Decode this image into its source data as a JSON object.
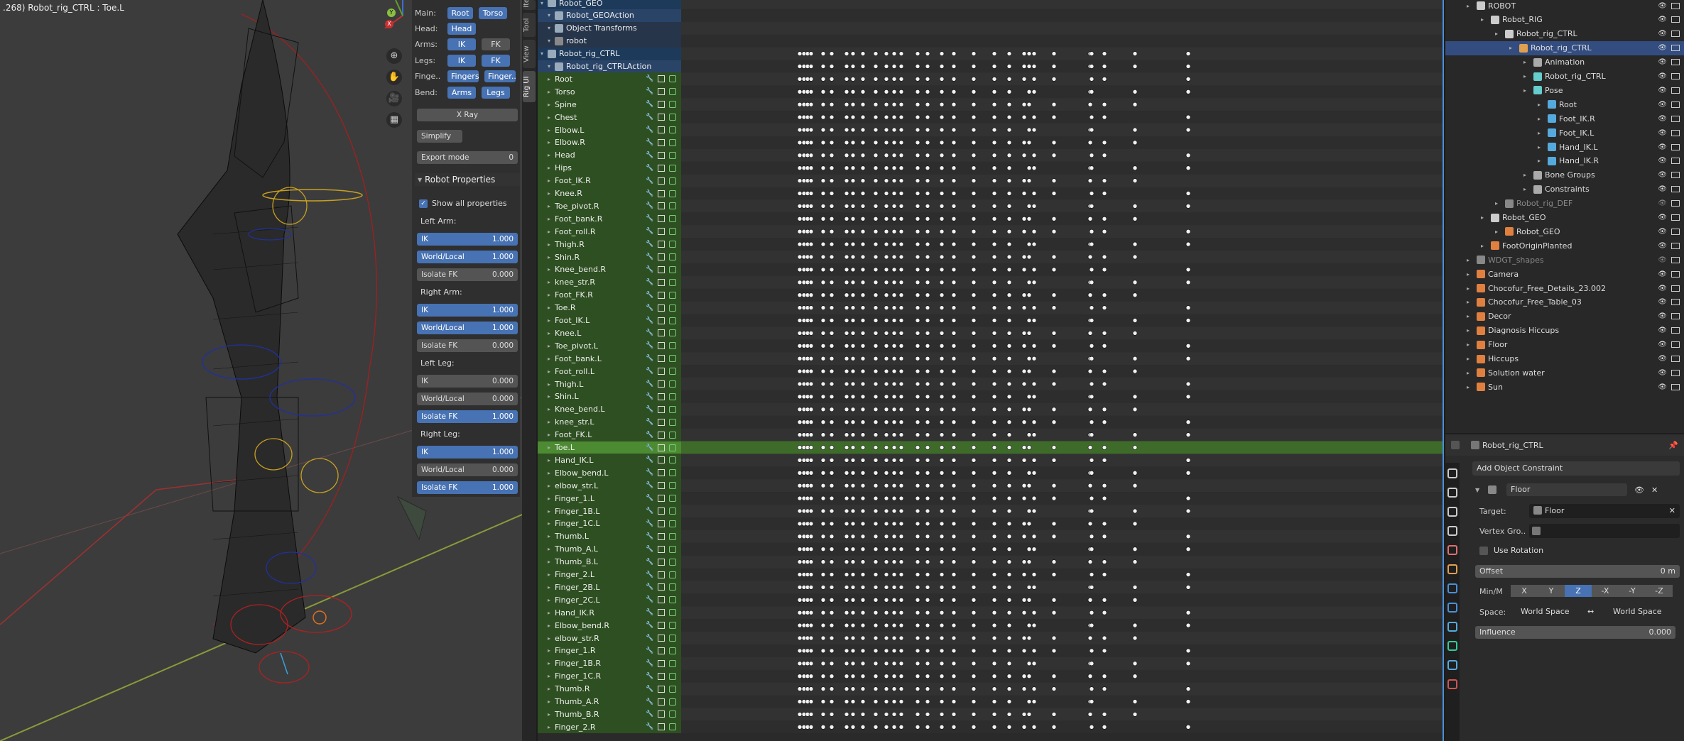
{
  "viewport": {
    "title": ".268) Robot_rig_CTRL : Toe.L"
  },
  "nav": {
    "x": "X",
    "y": "Y",
    "zoom": "⊕",
    "hand": "✋",
    "camera": "🎥",
    "grid": "▦"
  },
  "rigui": {
    "main": {
      "label": "Main:",
      "b1": "Root",
      "b2": "Torso"
    },
    "head": {
      "label": "Head:",
      "b1": "Head",
      "b2": ""
    },
    "arms": {
      "label": "Arms:",
      "b1": "IK",
      "b2": "FK"
    },
    "legs": {
      "label": "Legs:",
      "b1": "IK",
      "b2": "FK"
    },
    "fingers": {
      "label": "Finge..",
      "b1": "Fingers",
      "b2": "Finger.."
    },
    "bend": {
      "label": "Bend:",
      "b1": "Arms",
      "b2": "Legs"
    },
    "xray": "X Ray",
    "simplify": "Simplify",
    "export_label": "Export mode",
    "export_val": "0",
    "props_header": "Robot Properties",
    "show_all": "Show all properties",
    "left_arm": "Left Arm:",
    "right_arm": "Right Arm:",
    "left_leg": "Left Leg:",
    "right_leg": "Right Leg:",
    "ik": "IK",
    "wl": "World/Local",
    "iso": "Isolate FK",
    "la": [
      "1.000",
      "1.000",
      "0.000"
    ],
    "ra": [
      "1.000",
      "1.000",
      "0.000"
    ],
    "ll": [
      "0.000",
      "0.000",
      "1.000"
    ],
    "rl": [
      "1.000",
      "0.000",
      "1.000"
    ]
  },
  "tabs": [
    "Item",
    "Tool",
    "View",
    "Rig UI"
  ],
  "channels": {
    "top": [
      {
        "label": "Robot_GEO",
        "style": "o"
      },
      {
        "label": "Robot_GEOAction",
        "style": "o2"
      },
      {
        "label": "Object Transforms",
        "style": "o3"
      },
      {
        "label": "robot",
        "style": "o3"
      },
      {
        "label": "Robot_rig_CTRL",
        "style": "o"
      },
      {
        "label": "Robot_rig_CTRLAction",
        "style": "o2"
      }
    ],
    "bones": [
      "Root",
      "Torso",
      "Spine",
      "Chest",
      "Elbow.L",
      "Elbow.R",
      "Head",
      "Hips",
      "Foot_IK.R",
      "Knee.R",
      "Toe_pivot.R",
      "Foot_bank.R",
      "Foot_roll.R",
      "Thigh.R",
      "Shin.R",
      "Knee_bend.R",
      "knee_str.R",
      "Foot_FK.R",
      "Toe.R",
      "Foot_IK.L",
      "Knee.L",
      "Toe_pivot.L",
      "Foot_bank.L",
      "Foot_roll.L",
      "Thigh.L",
      "Shin.L",
      "Knee_bend.L",
      "knee_str.L",
      "Foot_FK.L",
      "Toe.L",
      "Hand_IK.L",
      "Elbow_bend.L",
      "elbow_str.L",
      "Finger_1.L",
      "Finger_1B.L",
      "Finger_1C.L",
      "Thumb.L",
      "Thumb_A.L",
      "Thumb_B.L",
      "Finger_2.L",
      "Finger_2B.L",
      "Finger_2C.L",
      "Hand_IK.R",
      "Elbow_bend.R",
      "elbow_str.R",
      "Finger_1.R",
      "Finger_1B.R",
      "Finger_1C.R",
      "Thumb.R",
      "Thumb_A.R",
      "Thumb_B.R",
      "Finger_2.R"
    ],
    "selected": "Toe.L"
  },
  "outliner": [
    {
      "label": "ROBOT",
      "indent": 0,
      "icon": "collection",
      "color": "#cccccc"
    },
    {
      "label": "Robot_RIG",
      "indent": 1,
      "icon": "collection",
      "color": "#cccccc"
    },
    {
      "label": "Robot_rig_CTRL",
      "indent": 2,
      "icon": "collection",
      "color": "#cccccc"
    },
    {
      "label": "Robot_rig_CTRL",
      "indent": 3,
      "icon": "armature",
      "color": "#e0a050",
      "sel": true
    },
    {
      "label": "Animation",
      "indent": 4,
      "icon": "anim",
      "color": "#aaaaaa"
    },
    {
      "label": "Robot_rig_CTRL",
      "indent": 4,
      "icon": "armdata",
      "color": "#6cc"
    },
    {
      "label": "Pose",
      "indent": 4,
      "icon": "pose",
      "color": "#6cc"
    },
    {
      "label": "Root",
      "indent": 5,
      "icon": "bone",
      "color": "#5ad"
    },
    {
      "label": "Foot_IK.R",
      "indent": 5,
      "icon": "bone",
      "color": "#5ad"
    },
    {
      "label": "Foot_IK.L",
      "indent": 5,
      "icon": "bone",
      "color": "#5ad"
    },
    {
      "label": "Hand_IK.L",
      "indent": 5,
      "icon": "bone",
      "color": "#5ad"
    },
    {
      "label": "Hand_IK.R",
      "indent": 5,
      "icon": "bone",
      "color": "#5ad"
    },
    {
      "label": "Bone Groups",
      "indent": 4,
      "icon": "group",
      "color": "#aaa"
    },
    {
      "label": "Constraints",
      "indent": 4,
      "icon": "constraint",
      "color": "#aaa"
    },
    {
      "label": "Robot_rig_DEF",
      "indent": 2,
      "icon": "collection",
      "color": "#888",
      "mute": true
    },
    {
      "label": "Robot_GEO",
      "indent": 1,
      "icon": "collection",
      "color": "#cccccc"
    },
    {
      "label": "Robot_GEO",
      "indent": 2,
      "icon": "mesh",
      "color": "#e08040"
    },
    {
      "label": "FootOriginPlanted",
      "indent": 1,
      "icon": "empty",
      "color": "#e08040"
    },
    {
      "label": "WDGT_shapes",
      "indent": 0,
      "icon": "collection",
      "color": "#888",
      "mute": true
    },
    {
      "label": "Camera",
      "indent": 0,
      "icon": "camera",
      "color": "#e08040"
    },
    {
      "label": "Chocofur_Free_Details_23.002",
      "indent": 0,
      "icon": "mesh",
      "color": "#e08040"
    },
    {
      "label": "Chocofur_Free_Table_03",
      "indent": 0,
      "icon": "mesh",
      "color": "#e08040"
    },
    {
      "label": "Decor",
      "indent": 0,
      "icon": "mesh",
      "color": "#e08040"
    },
    {
      "label": "Diagnosis Hiccups",
      "indent": 0,
      "icon": "text",
      "color": "#e08040"
    },
    {
      "label": "Floor",
      "indent": 0,
      "icon": "mesh",
      "color": "#e08040"
    },
    {
      "label": "Hiccups",
      "indent": 0,
      "icon": "text",
      "color": "#e08040"
    },
    {
      "label": "Solution water",
      "indent": 0,
      "icon": "text",
      "color": "#e08040"
    },
    {
      "label": "Sun",
      "indent": 0,
      "icon": "light",
      "color": "#e08040"
    }
  ],
  "properties": {
    "object": "Robot_rig_CTRL",
    "add": "Add Object Constraint",
    "constraint": "Floor",
    "target_label": "Target:",
    "target": "Floor",
    "vgroup_label": "Vertex Gro..",
    "use_rot": "Use Rotation",
    "offset_label": "Offset",
    "offset": "0 m",
    "minm": "Min/M",
    "axes": [
      "X",
      "Y",
      "Z",
      "-X",
      "-Y",
      "-Z"
    ],
    "active_axis": "Z",
    "space_label": "Space:",
    "space1": "World Space",
    "arrow": "↔",
    "space2": "World Space",
    "influence_label": "Influence",
    "influence": "0.000"
  }
}
